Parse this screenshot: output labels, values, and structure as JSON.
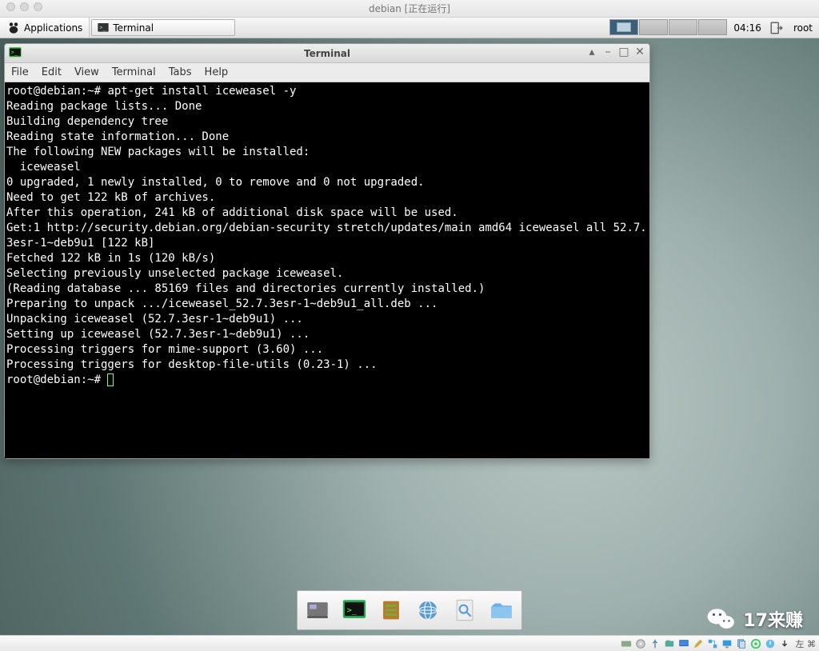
{
  "vm": {
    "title": "debian [正在运行]",
    "hostkey": "左 ⌘"
  },
  "panel": {
    "applications": "Applications",
    "task_terminal": "Terminal",
    "clock": "04:16",
    "user": "root"
  },
  "terminal": {
    "title": "Terminal",
    "menu": [
      "File",
      "Edit",
      "View",
      "Terminal",
      "Tabs",
      "Help"
    ],
    "prompt1": "root@debian:~# ",
    "command1": "apt-get install iceweasel -y",
    "output": "Reading package lists... Done\nBuilding dependency tree\nReading state information... Done\nThe following NEW packages will be installed:\n  iceweasel\n0 upgraded, 1 newly installed, 0 to remove and 0 not upgraded.\nNeed to get 122 kB of archives.\nAfter this operation, 241 kB of additional disk space will be used.\nGet:1 http://security.debian.org/debian-security stretch/updates/main amd64 iceweasel all 52.7.3esr-1~deb9u1 [122 kB]\nFetched 122 kB in 1s (120 kB/s)\nSelecting previously unselected package iceweasel.\n(Reading database ... 85169 files and directories currently installed.)\nPreparing to unpack .../iceweasel_52.7.3esr-1~deb9u1_all.deb ...\nUnpacking iceweasel (52.7.3esr-1~deb9u1) ...\nSetting up iceweasel (52.7.3esr-1~deb9u1) ...\nProcessing triggers for mime-support (3.60) ...\nProcessing triggers for desktop-file-utils (0.23-1) ...",
    "prompt2": "root@debian:~# "
  },
  "watermark": {
    "text": "17来赚"
  }
}
